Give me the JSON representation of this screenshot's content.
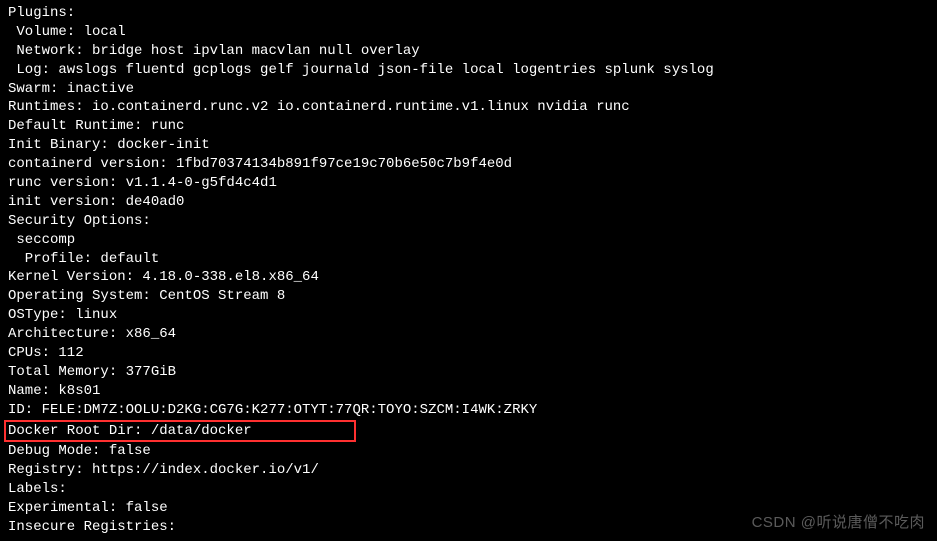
{
  "lines": {
    "plugins": "Plugins:",
    "volume": " Volume: local",
    "network": " Network: bridge host ipvlan macvlan null overlay",
    "log": " Log: awslogs fluentd gcplogs gelf journald json-file local logentries splunk syslog",
    "swarm": "Swarm: inactive",
    "runtimes": "Runtimes: io.containerd.runc.v2 io.containerd.runtime.v1.linux nvidia runc",
    "default_runtime": "Default Runtime: runc",
    "init_binary": "Init Binary: docker-init",
    "containerd_version": "containerd version: 1fbd70374134b891f97ce19c70b6e50c7b9f4e0d",
    "runc_version": "runc version: v1.1.4-0-g5fd4c4d1",
    "init_version": "init version: de40ad0",
    "security_options": "Security Options:",
    "seccomp": " seccomp",
    "profile": "  Profile: default",
    "kernel_version": "Kernel Version: 4.18.0-338.el8.x86_64",
    "operating_system": "Operating System: CentOS Stream 8",
    "ostype": "OSType: linux",
    "architecture": "Architecture: x86_64",
    "cpus": "CPUs: 112",
    "total_memory": "Total Memory: 377GiB",
    "name": "Name: k8s01",
    "id": "ID: FELE:DM7Z:OOLU:D2KG:CG7G:K277:OTYT:77QR:TOYO:SZCM:I4WK:ZRKY",
    "docker_root_dir": "Docker Root Dir: /data/docker",
    "debug_mode": "Debug Mode: false",
    "registry": "Registry: https://index.docker.io/v1/",
    "labels": "Labels:",
    "experimental": "Experimental: false",
    "insecure_registries": "Insecure Registries:"
  },
  "watermark": "CSDN @听说唐僧不吃肉"
}
